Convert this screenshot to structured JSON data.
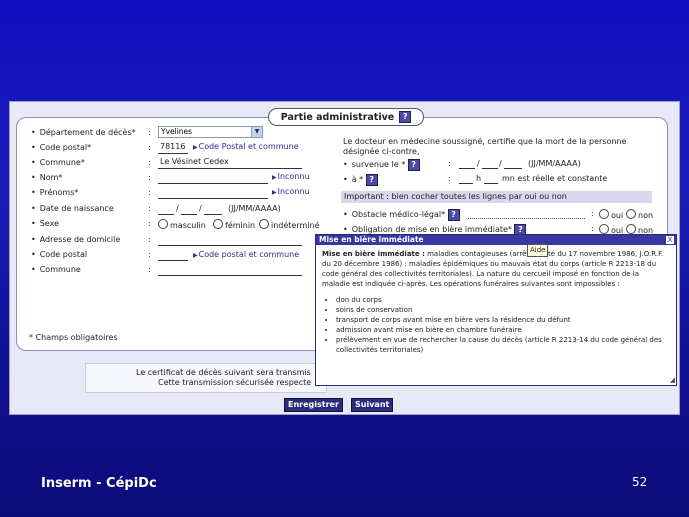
{
  "section_title": "Partie administrative",
  "help_icon": "?",
  "left_fields": [
    {
      "label": "Département de décès*",
      "value": "Yvelines"
    },
    {
      "label": "Code postal*",
      "value": "78116",
      "link": "Code Postal et commune"
    },
    {
      "label": "Commune*",
      "value": "Le Vésinet Cedex"
    },
    {
      "label": "Nom*",
      "link": "Inconnu"
    },
    {
      "label": "Prénoms*",
      "link": "Inconnu"
    },
    {
      "label": "Date de naissance",
      "format": "(JJ/MM/AAAA)"
    },
    {
      "label": "Sexe",
      "options": [
        "masculin",
        "féminin",
        "indéterminé"
      ]
    },
    {
      "label": "Adresse de domicile"
    },
    {
      "label": "Code postal",
      "link": "Code postal et commune"
    },
    {
      "label": "Commune"
    }
  ],
  "required_note": "* Champs obligatoires",
  "certify_text": [
    "Le docteur en médecine soussigné, certifie que la mort de la personne",
    "désignée ci-contre,"
  ],
  "survenue": {
    "label": "survenue le *",
    "format": "(JJ/MM/AAAA)"
  },
  "a_heure": {
    "label": "à *",
    "h": "h",
    "mn": "mn est réelle et constante"
  },
  "important_text": "Important : bien cocher toutes les lignes par oui ou non",
  "obstacle": {
    "label": "Obstacle médico-légal*",
    "oui": "oui",
    "non": "non"
  },
  "obligation": {
    "label": "Obligation de mise en bière immédiate*",
    "oui": "oui",
    "non": "non"
  },
  "info_text": [
    "Le certificat de décès suivant sera transmis",
    "Cette transmission sécurisée respecte"
  ],
  "buttons": {
    "save": "Enregistrer",
    "next": "Suivant"
  },
  "popup": {
    "title": "Mise en bière immédiate",
    "close": "X",
    "tooltip": "Aide",
    "intro_bold": "Mise en bière immédiate :",
    "intro_text": " maladies contagieuses (arrêté santé du 17 novembre 1986, J.O.R.F. du 20 décembre 1986) : maladies épidémiques ou mauvais état du corps (article R 2213-18 du code général des collectivités territoriales). La nature du cercueil imposé en fonction de la maladie est indiquée ci-après. Les opérations funéraires suivantes sont impossibles :",
    "items": [
      "don du corps",
      "soins de conservation",
      "transport de corps avant mise en bière vers la résidence du défunt",
      "admission avant mise en bière en chambre funéraire",
      "prélèvement en vue de rechercher la cause du décès (article R 2213-14 du code général des collectivités territoriales)"
    ]
  },
  "footer": {
    "brand": "Inserm - CépiDc",
    "page": "52"
  }
}
